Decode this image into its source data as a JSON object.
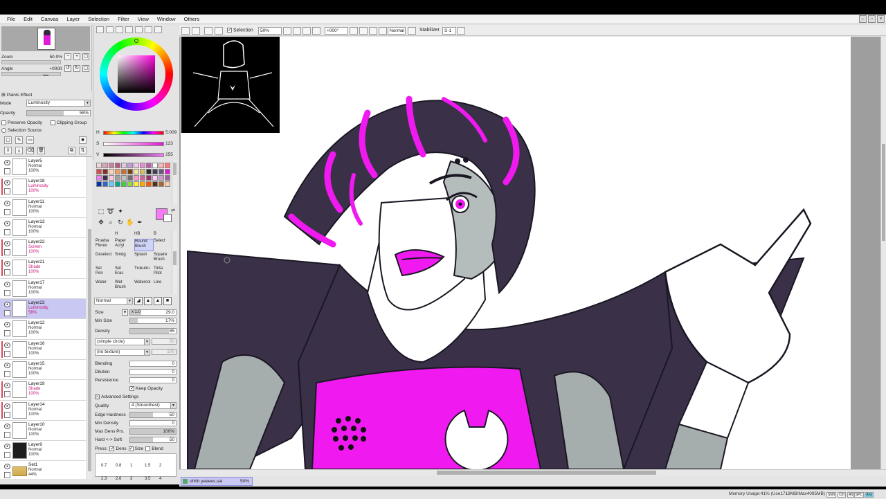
{
  "menu": [
    "File",
    "Edit",
    "Canvas",
    "Layer",
    "Selection",
    "Filter",
    "View",
    "Window",
    "Others"
  ],
  "navigator": {
    "zoom_label": "Zoom",
    "zoom_value": "50.0%",
    "angle_label": "Angle",
    "angle_value": "+000ß"
  },
  "layer_props": {
    "paints_effect": "Paints Effect",
    "mode_label": "Mode",
    "mode_value": "Luminosity",
    "opacity_label": "Opacity",
    "opacity_value": "58%",
    "opacity_fraction": 0.58,
    "preserve_opacity": "Preserve Opacity",
    "clipping_group": "Clipping Group",
    "selection_source": "Selection Source"
  },
  "layers": [
    {
      "name": "Layer5",
      "mode": "Normal",
      "opacity": "100%",
      "mark": ""
    },
    {
      "name": "Layer18",
      "mode": "Luminosity",
      "opacity": "100%",
      "mark": "#d9485d"
    },
    {
      "name": "Layer11",
      "mode": "Normal",
      "opacity": "100%",
      "mark": ""
    },
    {
      "name": "Layer13",
      "mode": "Normal",
      "opacity": "100%",
      "mark": ""
    },
    {
      "name": "Layer22",
      "mode": "Screen",
      "opacity": "100%",
      "mark": "#d9485d"
    },
    {
      "name": "Layer21",
      "mode": "Shade",
      "opacity": "100%",
      "mark": "#d9485d"
    },
    {
      "name": "Layer17",
      "mode": "Normal",
      "opacity": "100%",
      "mark": ""
    },
    {
      "name": "Layer23",
      "mode": "Luminosity",
      "opacity": "58%",
      "mark": "",
      "selected": true
    },
    {
      "name": "Layer12",
      "mode": "Normal",
      "opacity": "100%",
      "mark": ""
    },
    {
      "name": "Layer16",
      "mode": "Normal",
      "opacity": "100%",
      "mark": "#d9485d"
    },
    {
      "name": "Layer15",
      "mode": "Normal",
      "opacity": "100%",
      "mark": ""
    },
    {
      "name": "Layer19",
      "mode": "Shade",
      "opacity": "100%",
      "mark": "#d9485d"
    },
    {
      "name": "Layer14",
      "mode": "Normal",
      "opacity": "100%",
      "mark": "#d9485d"
    },
    {
      "name": "Layer10",
      "mode": "Normal",
      "opacity": "100%",
      "mark": ""
    },
    {
      "name": "Layer9",
      "mode": "Normal",
      "opacity": "100%",
      "mark": "",
      "dark": true
    },
    {
      "name": "Set1",
      "mode": "Normal",
      "opacity": "44%",
      "mark": "",
      "folder": true
    }
  ],
  "color": {
    "h_label": "H",
    "h_value": "5:009",
    "s_label": "S",
    "s_value": "123",
    "v_label": "V",
    "v_value": "255",
    "current": "#f57cf5"
  },
  "palette": [
    "#f3d6d8",
    "#d9a3b3",
    "#c9829c",
    "#b35b7e",
    "#e0c9e8",
    "#c59bd6",
    "#f7c9f0",
    "#e98fd6",
    "#c15ab0",
    "#ffffff",
    "#ffb3b3",
    "#ff7a7a",
    "#d94a4a",
    "#8a2b2b",
    "#ffd9b3",
    "#f0a060",
    "#c9702c",
    "#7a4010",
    "#f5e6a0",
    "#d6c060",
    "#2a2a2a",
    "#4a3a5a",
    "#6a5a7a",
    "#e01ad6",
    "#f57cf5",
    "#3a3048",
    "#ffcce0",
    "#a0a0a0",
    "#c0c0c0",
    "#707070",
    "#ff99cc",
    "#cc6699",
    "#993366",
    "#ffccff",
    "#cc99cc",
    "#996699",
    "#0033aa",
    "#3366cc",
    "#66ccff",
    "#00aa88",
    "#44cc44",
    "#88dd44",
    "#ffee33",
    "#ffaa00",
    "#ff5500",
    "#553311",
    "#aa6633",
    "#ffccaa"
  ],
  "brushes": [
    {
      "a": "Prueba",
      "b": "Floreo"
    },
    {
      "a": "Paper",
      "b": "Acryl"
    },
    {
      "a": "Round",
      "b": "Brush",
      "selected": true
    },
    {
      "a": "Select",
      "b": ""
    },
    {
      "a": "Deselect",
      "b": ""
    },
    {
      "a": "Smdg",
      "b": ""
    },
    {
      "a": "Splash",
      "b": ""
    },
    {
      "a": "Square",
      "b": "Brush"
    },
    {
      "a": "Sel",
      "b": "Pen"
    },
    {
      "a": "Sel",
      "b": "Eras"
    },
    {
      "a": "Trukutru",
      "b": ""
    },
    {
      "a": "Tinta",
      "b": "Pilot"
    },
    {
      "a": "Water",
      "b": ""
    },
    {
      "a": "Wet",
      "b": "Brush"
    },
    {
      "a": "Watercol",
      "b": ""
    },
    {
      "a": "Line",
      "b": ""
    }
  ],
  "brush_row_top": [
    "",
    "H",
    "HB",
    "B"
  ],
  "brush_opts": {
    "blend_mode": "Normal",
    "size_label": "Size",
    "size_mult": "x 1.0",
    "size_value": "29.0",
    "min_size_label": "Min Size",
    "min_size_value": "17%",
    "min_size_fraction": 0.17,
    "density_label": "Density",
    "density_value": "85",
    "density_fraction": 0.85,
    "shape": "(simple circle)",
    "shape_num": "50",
    "texture": "(no texture)",
    "texture_num": "100",
    "blending_label": "Blending",
    "blending_value": "0",
    "dilution_label": "Dilution",
    "dilution_value": "0",
    "persistence_label": "Persistence",
    "persistence_value": "0",
    "keep_opacity": "Keep Opacity",
    "advanced": "Advanced Settings",
    "quality_label": "Quality",
    "quality_value": "4 (Smoothest)",
    "edge_label": "Edge Hardness",
    "edge_value": "50",
    "edge_fraction": 0.5,
    "min_density_label": "Min Density",
    "min_density_value": "0",
    "max_dens_label": "Max Dens Prs.",
    "max_dens_value": "100%",
    "max_dens_fraction": 1.0,
    "hardsoft_label": "Hard <-> Soft",
    "hardsoft_value": "50",
    "hardsoft_fraction": 0.5,
    "press_label": "Press:",
    "press_dens": "Dens",
    "press_size": "Size",
    "press_blend": "Blend",
    "sizes_row1": [
      "0.7",
      "0.8",
      "1",
      "1.5",
      "2"
    ],
    "sizes_row2": [
      "2.3",
      "2.6",
      "3",
      "3.5",
      "4"
    ]
  },
  "toolbar": {
    "selection_label": "Selection",
    "zoom_value": "50%",
    "angle_value": "+000°",
    "mode_value": "Normal",
    "stabilizer_label": "Stabilizer",
    "stabilizer_value": "S-1"
  },
  "tab": {
    "name": "ohhh yeeees.sai",
    "zoom": "50%"
  },
  "status": {
    "memory": "Memory Usage:41% (Use1718MB/Max4095MB)",
    "keys": [
      "Shift",
      "Ctrl",
      "Alt",
      "SPC",
      "Any"
    ]
  },
  "accent": "#e01ad6"
}
